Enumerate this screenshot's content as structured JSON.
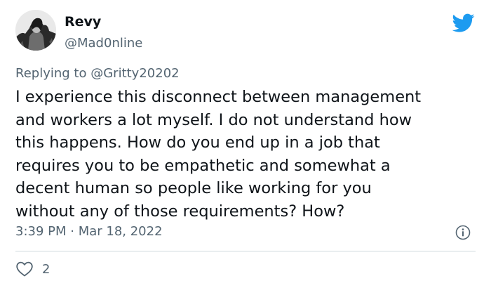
{
  "tweet": {
    "author": {
      "display_name": "Revy",
      "handle": "@Mad0nline",
      "avatar_icon": "avatar-image"
    },
    "brand_icon": "twitter-bird-icon",
    "brand_color": "#1d9bf0",
    "reply": {
      "prefix": "Replying to",
      "target": "@Gritty20202"
    },
    "text": "I experience this disconnect between management\nand workers a lot myself. I do not understand how\nthis happens. How do you end up in a job that\nrequires you to be empathetic and somewhat a\ndecent human so people like working for you\nwithout any of those requirements? How?",
    "timestamp": "3:39 PM · Mar 18, 2022",
    "info_icon": "info-icon",
    "likes": {
      "icon": "heart-icon",
      "count": "2"
    }
  }
}
